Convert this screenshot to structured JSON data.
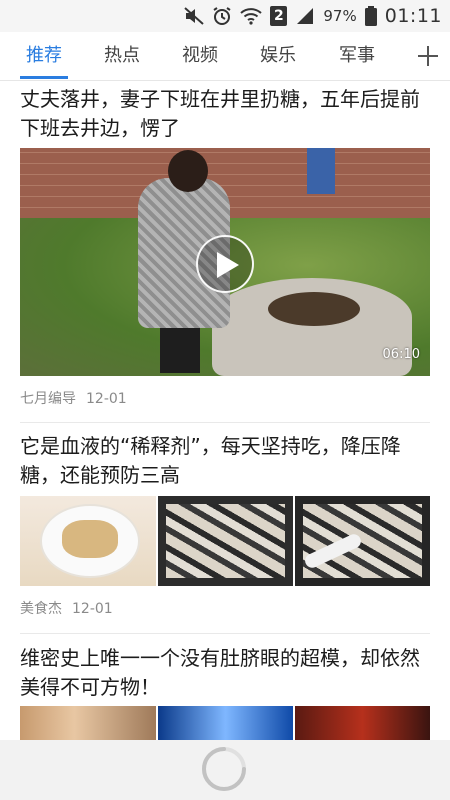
{
  "status_bar": {
    "icons": [
      "mute-icon",
      "alarm-icon",
      "wifi-icon",
      "sim-2-icon",
      "signal-icon",
      "battery-icon"
    ],
    "sim_label": "2",
    "battery": "97%",
    "time": "01:11"
  },
  "tabs": {
    "items": [
      {
        "label": "推荐",
        "active": true
      },
      {
        "label": "热点",
        "active": false
      },
      {
        "label": "视频",
        "active": false
      },
      {
        "label": "娱乐",
        "active": false
      },
      {
        "label": "军事",
        "active": false
      }
    ],
    "add_icon": "plus-icon",
    "accent_color": "#2a7de0"
  },
  "feed": {
    "items": [
      {
        "title": "丈夫落井，妻子下班在井里扔糖，五年后提前下班去井边，愣了",
        "type": "video",
        "duration": "06:10",
        "source": "七月编导",
        "date": "12-01"
      },
      {
        "title": "它是血液的“稀释剂”，每天坚持吃，降压降糖，还能预防三高",
        "type": "three-images",
        "source": "美食杰",
        "date": "12-01"
      },
      {
        "title": "维密史上唯一一个没有肚脐眼的超模，却依然美得不可方物！",
        "type": "three-images"
      }
    ]
  },
  "loading": {
    "icon": "loading-spinner-icon"
  }
}
